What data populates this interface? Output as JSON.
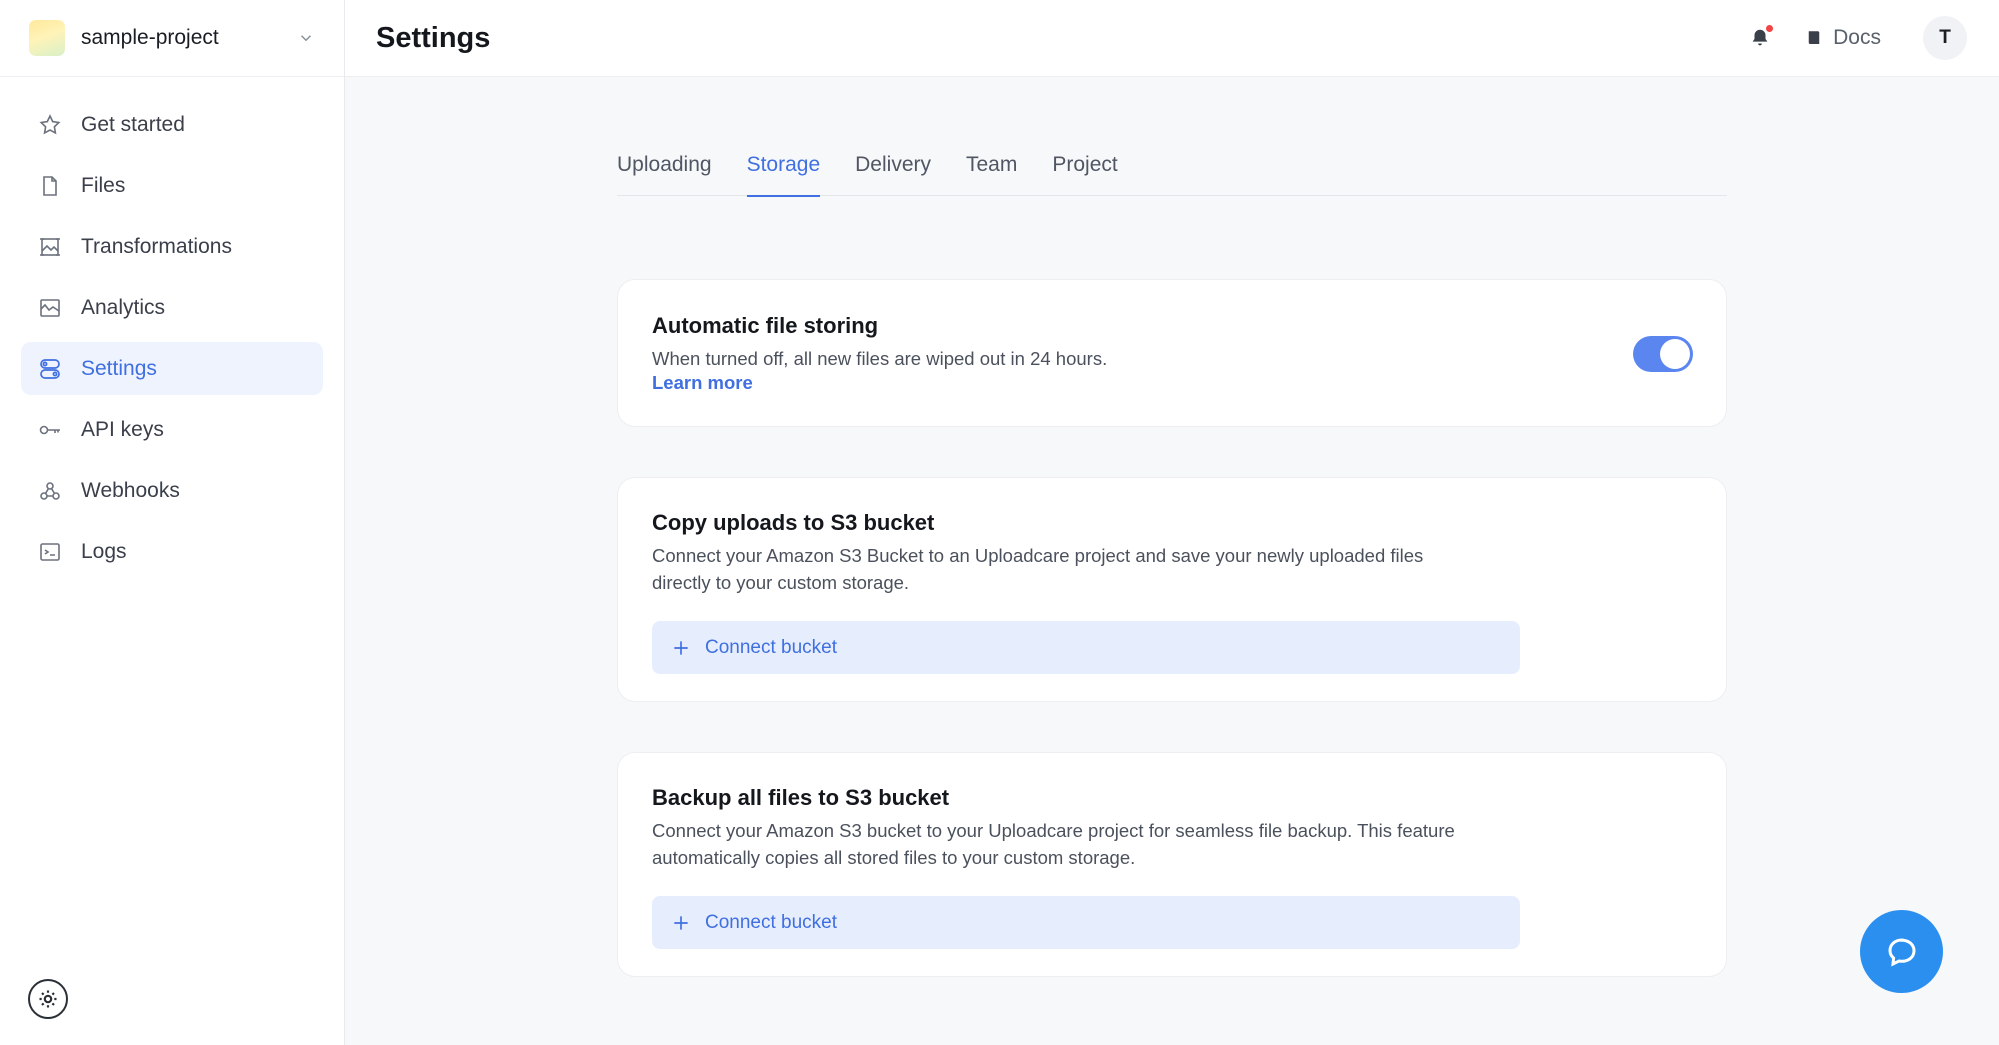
{
  "project": {
    "name": "sample-project"
  },
  "sidebar": {
    "items": [
      {
        "label": "Get started",
        "icon": "star-icon"
      },
      {
        "label": "Files",
        "icon": "file-icon"
      },
      {
        "label": "Transformations",
        "icon": "image-transform-icon"
      },
      {
        "label": "Analytics",
        "icon": "chart-icon"
      },
      {
        "label": "Settings",
        "icon": "settings-toggle-icon",
        "active": true
      },
      {
        "label": "API keys",
        "icon": "key-icon"
      },
      {
        "label": "Webhooks",
        "icon": "webhook-icon"
      },
      {
        "label": "Logs",
        "icon": "terminal-icon"
      }
    ]
  },
  "header": {
    "title": "Settings",
    "docs_label": "Docs",
    "avatar_initial": "T"
  },
  "tabs": [
    {
      "label": "Uploading"
    },
    {
      "label": "Storage",
      "active": true
    },
    {
      "label": "Delivery"
    },
    {
      "label": "Team"
    },
    {
      "label": "Project"
    }
  ],
  "cards": {
    "auto_store": {
      "title": "Automatic file storing",
      "description": "When turned off, all new files are wiped out in 24 hours.",
      "link": "Learn more",
      "enabled": true
    },
    "copy_s3": {
      "title": "Copy uploads to S3 bucket",
      "description_line1": "Connect your Amazon S3 Bucket to an Uploadcare project and save your newly uploaded files",
      "description_line2": "directly to your custom storage.",
      "button": "Connect bucket"
    },
    "backup_s3": {
      "title": "Backup all files to S3 bucket",
      "description_line1": "Connect your Amazon S3 bucket to your Uploadcare project for seamless file backup. This feature",
      "description_line2": "automatically copies all stored files to your custom storage.",
      "button": "Connect bucket"
    }
  },
  "colors": {
    "accent": "#3f6fe0",
    "toggle_on": "#5b86f0",
    "chat": "#2b8ff0"
  }
}
